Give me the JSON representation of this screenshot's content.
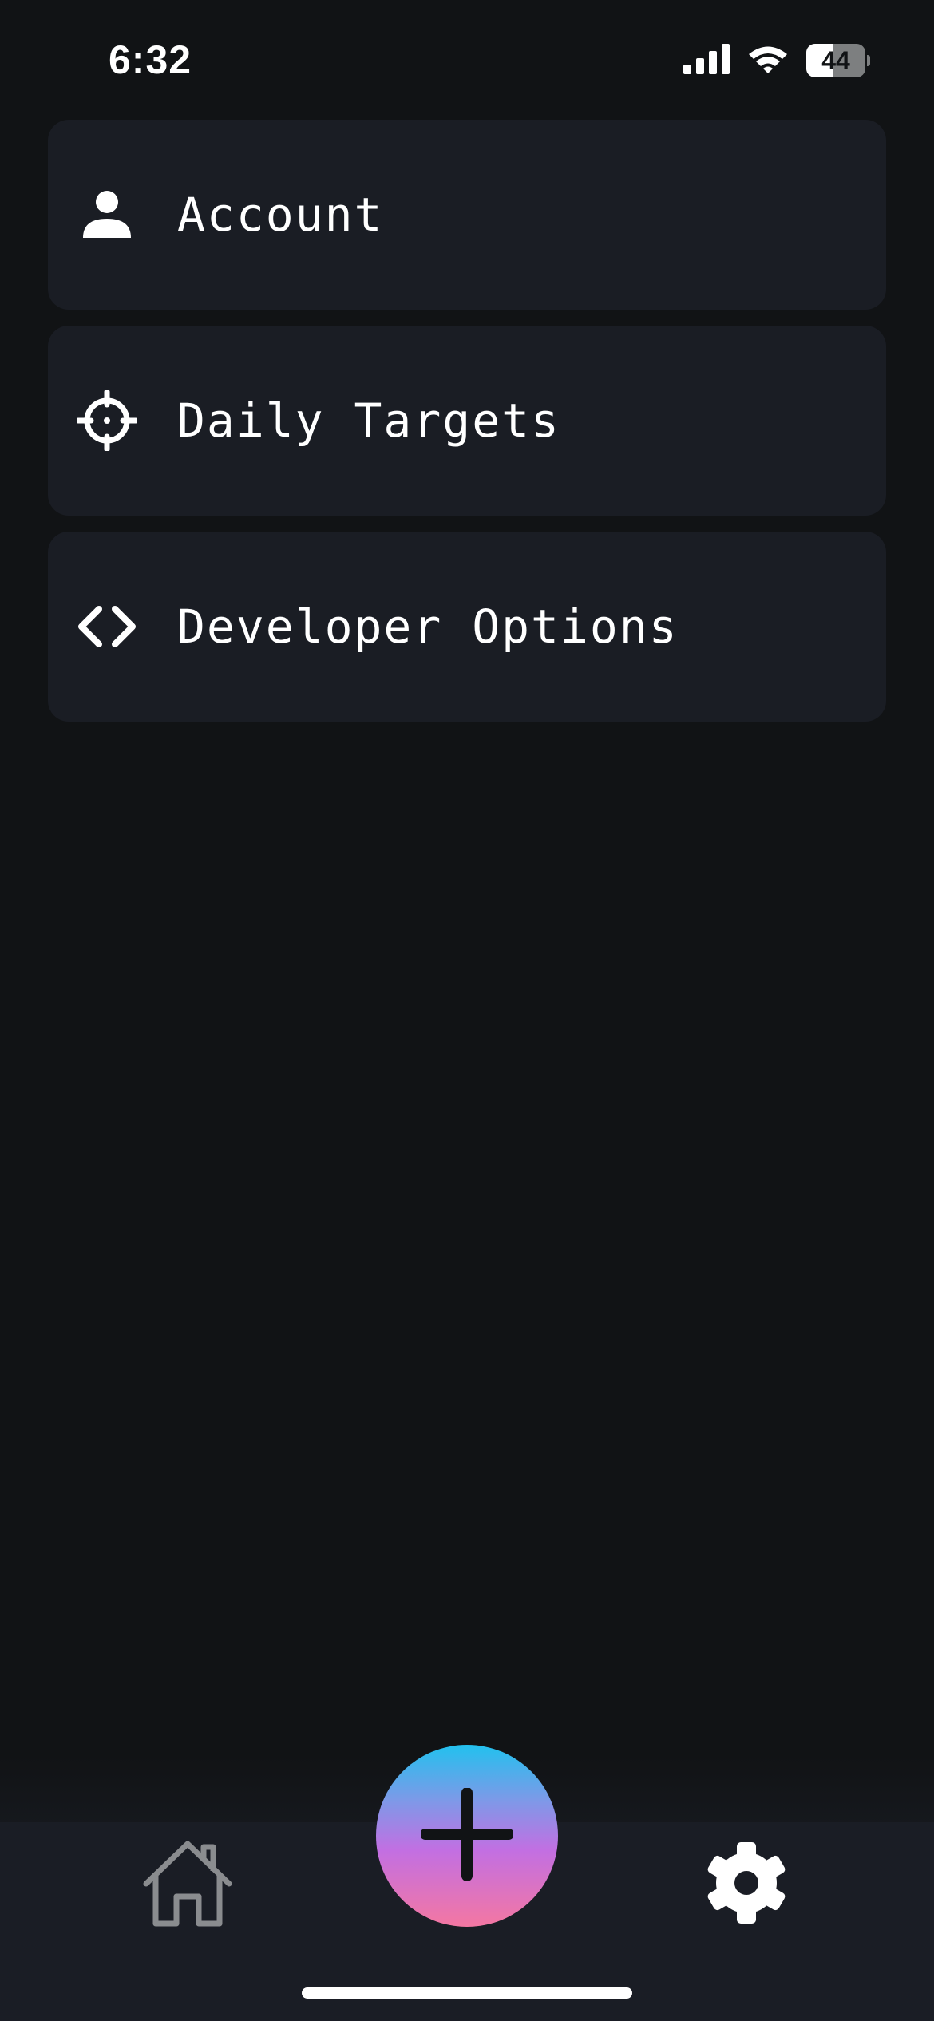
{
  "status_bar": {
    "time": "6:32",
    "battery_level": "44",
    "battery_fraction": 0.44,
    "icons": [
      "cellular-signal-icon",
      "wifi-icon",
      "battery-icon"
    ]
  },
  "settings": {
    "items": [
      {
        "label": "Account",
        "icon": "person-icon"
      },
      {
        "label": "Daily Targets",
        "icon": "crosshair-target-icon"
      },
      {
        "label": "Developer Options",
        "icon": "code-brackets-icon"
      }
    ]
  },
  "tab_bar": {
    "tabs": [
      {
        "name": "home",
        "icon": "home-icon",
        "active": false
      },
      {
        "name": "add",
        "icon": "plus-icon"
      },
      {
        "name": "settings",
        "icon": "gear-icon",
        "active": true
      }
    ]
  },
  "colors": {
    "background": "#111315",
    "card": "#1a1d24",
    "tab_bar": "#1a1d25",
    "inactive_icon": "#8a8c8f",
    "active_icon": "#ffffff",
    "fab_gradient": [
      "#22c1ee",
      "#c26fe2",
      "#f477a2"
    ]
  }
}
